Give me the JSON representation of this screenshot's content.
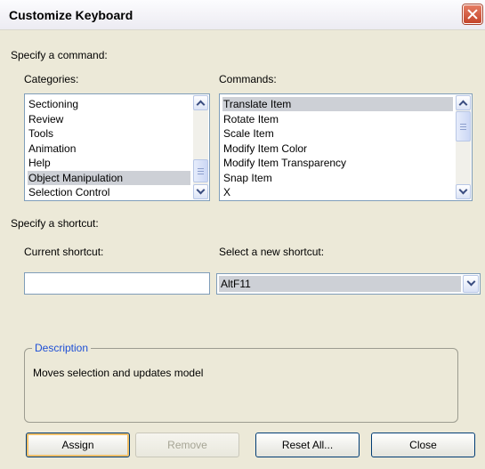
{
  "dialog": {
    "title": "Customize Keyboard"
  },
  "command_section": {
    "heading": "Specify a command:",
    "categories_label": "Categories:",
    "commands_label": "Commands:",
    "categories": [
      "Sectioning",
      "Review",
      "Tools",
      "Animation",
      "Help",
      "Object Manipulation",
      "Selection Control"
    ],
    "selected_category": "Object Manipulation",
    "commands": [
      "Translate Item",
      "Rotate Item",
      "Scale Item",
      "Modify Item Color",
      "Modify Item Transparency",
      "Snap Item",
      "X"
    ],
    "selected_command": "Translate Item"
  },
  "shortcut_section": {
    "heading": "Specify a shortcut:",
    "current_label": "Current shortcut:",
    "current_value": "",
    "new_label": "Select a new shortcut:",
    "new_value": "AltF11"
  },
  "description": {
    "legend": "Description",
    "text": "Moves selection and updates model"
  },
  "buttons": {
    "assign": "Assign",
    "remove": "Remove",
    "reset_all": "Reset All...",
    "close": "Close"
  },
  "icons": {
    "close": "close-x-icon",
    "scroll_up": "chevron-up-icon",
    "scroll_down": "chevron-down-icon",
    "dropdown": "chevron-down-icon"
  }
}
